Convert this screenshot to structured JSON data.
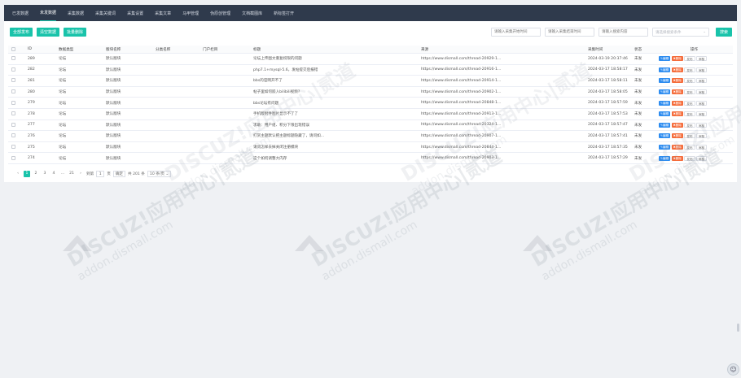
{
  "nav": {
    "items": [
      {
        "label": "已发数据",
        "active": false
      },
      {
        "label": "未发数据",
        "active": true
      },
      {
        "label": "采集数据",
        "active": false
      },
      {
        "label": "采集关键词",
        "active": false
      },
      {
        "label": "采集设置",
        "active": false
      },
      {
        "label": "采集文章",
        "active": false
      },
      {
        "label": "马甲管理",
        "active": false
      },
      {
        "label": "伪原创管理",
        "active": false
      },
      {
        "label": "文档截图库",
        "active": false
      },
      {
        "label": "新标签打开",
        "active": false
      }
    ]
  },
  "actions": {
    "publish_all": "全部发布",
    "delete_all": "清空数据",
    "batch_delete": "批量删除"
  },
  "filters": {
    "start_time_placeholder": "请输入采集开始时间",
    "end_time_placeholder": "请输入采集结束时间",
    "title_placeholder": "请输入搜索内容",
    "status_placeholder": "请选择搜索条件",
    "search_label": "搜索"
  },
  "table": {
    "headers": [
      "",
      "ID",
      "数据类型",
      "版块名称",
      "分类名称",
      "门户栏目",
      "标题",
      "来源",
      "采集时间",
      "状态",
      "操作"
    ],
    "rows": [
      {
        "id": "289",
        "type": "论坛",
        "forum": "默认版块",
        "category": "",
        "portal": "",
        "title": "论坛上传图文重复权限的问题",
        "source": "https://www.dismall.com/thread-20929-1...",
        "time": "2024-03-19 20:37:46",
        "status": "未发"
      },
      {
        "id": "282",
        "type": "论坛",
        "forum": "默认版块",
        "category": "",
        "portal": "",
        "title": "php7.1+mysql-5.6，发帖提交后报错",
        "source": "https://www.dismall.com/thread-20916-1...",
        "time": "2024-03-17 18:58:17",
        "status": "未发"
      },
      {
        "id": "281",
        "type": "论坛",
        "forum": "默认版块",
        "category": "",
        "portal": "",
        "title": "bbs的官网开不了",
        "source": "https://www.dismall.com/thread-20914-1...",
        "time": "2024-03-17 18:58:11",
        "status": "未发"
      },
      {
        "id": "280",
        "type": "论坛",
        "forum": "默认版块",
        "category": "",
        "portal": "",
        "title": "帖子里如何嵌入bilibili视频?",
        "source": "https://www.dismall.com/thread-20902-1...",
        "time": "2024-03-17 18:58:05",
        "status": "未发"
      },
      {
        "id": "279",
        "type": "论坛",
        "forum": "默认版块",
        "category": "",
        "portal": "",
        "title": "bbs论坛有问题",
        "source": "https://www.dismall.com/thread-20848-1...",
        "time": "2024-03-17 18:57:59",
        "status": "未发"
      },
      {
        "id": "278",
        "type": "论坛",
        "forum": "默认版块",
        "category": "",
        "portal": "",
        "title": "手机版附件图片显示不了了",
        "source": "https://www.dismall.com/thread-20913-1...",
        "time": "2024-03-17 18:57:53",
        "status": "未发"
      },
      {
        "id": "277",
        "type": "论坛",
        "forum": "默认版块",
        "category": "",
        "portal": "",
        "title": "求助：用户组、积分下限出现错误",
        "source": "https://www.dismall.com/thread-20324-1...",
        "time": "2024-03-17 18:57:47",
        "status": "未发"
      },
      {
        "id": "276",
        "type": "论坛",
        "forum": "默认版块",
        "category": "",
        "portal": "",
        "title": "打赏主题默认把主题标题隐藏了，请问如...",
        "source": "https://www.dismall.com/thread-20907-1...",
        "time": "2024-03-17 18:57:41",
        "status": "未发"
      },
      {
        "id": "275",
        "type": "论坛",
        "forum": "默认版块",
        "category": "",
        "portal": "",
        "title": "请问怎样去掉关闭注册模块",
        "source": "https://www.dismall.com/thread-20844-1...",
        "time": "2024-03-17 18:57:35",
        "status": "未发"
      },
      {
        "id": "274",
        "type": "论坛",
        "forum": "默认版块",
        "category": "",
        "portal": "",
        "title": "这个如何调整大内存",
        "source": "https://www.dismall.com/thread-20903-1...",
        "time": "2024-03-17 18:57:29",
        "status": "未发"
      }
    ],
    "row_ops": {
      "edit": "✎编辑",
      "delete": "✖删除",
      "publish": "发布",
      "review": "审核"
    }
  },
  "pagination": {
    "pages": [
      "1",
      "2",
      "3",
      "4",
      "...",
      "21"
    ],
    "goto_prefix": "到第",
    "goto_value": "1",
    "goto_suffix": "页",
    "confirm": "确定",
    "total": "共 201 条",
    "page_size": "10 条/页"
  },
  "watermark": {
    "brand": "DISCUZ!应用中心|贰道",
    "domain": "addon.dismall.com"
  }
}
